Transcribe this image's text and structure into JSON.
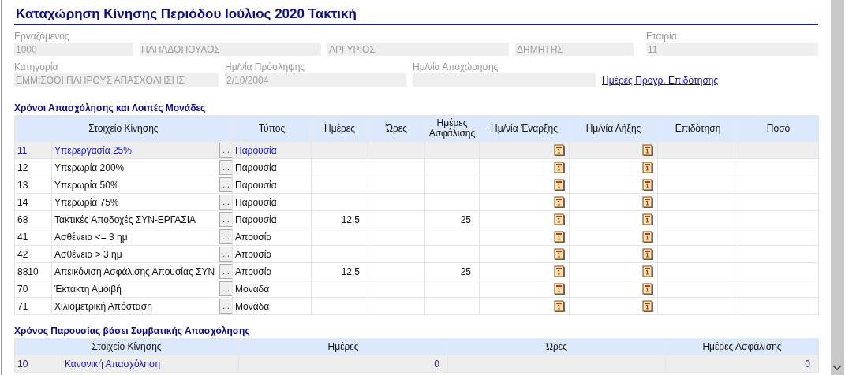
{
  "title": "Καταχώρηση Κίνησης Περιόδου Ιούλιος 2020 Τακτική",
  "employee": {
    "label": "Εργαζόμενος",
    "disabled": true,
    "fields": [
      "1000",
      "ΠΑΠΑΔΟΠΟΥΛΟΣ",
      "ΑΡΓΥΡΙΟΣ",
      "ΔΗΜΗΤΗΣ"
    ]
  },
  "company": {
    "label": "Εταιρία",
    "disabled": true,
    "value": "11"
  },
  "category": {
    "label": "Κατηγορία",
    "disabled": true,
    "value": "ΕΜΜΙΣΘΟΙ ΠΛΗΡΟΥΣ ΑΠΑΣΧΟΛΗΣΗΣ"
  },
  "hire_date": {
    "label": "Ημ/νία Πρόσληψης",
    "disabled": true,
    "value": "2/10/2004"
  },
  "departure_date": {
    "label": "Ημ/νία Αποχώρησης"
  },
  "link": "Ημέρες Προγρ. Επιδότησης",
  "movements": {
    "title": "Χρόνοι Απασχόλησης και Λοιπές Μονάδες",
    "columns": [
      "Στοιχείο Κίνησης",
      "Τύπος",
      "Ημέρες",
      "Ώρες",
      "Ημέρες Ασφάλισης",
      "Ημ/νία Έναρξης",
      "Ημ/νία Λήξης",
      "Επιδότηση",
      "Ποσό"
    ],
    "rows": [
      {
        "code": "11",
        "name": "Υπερεργασία 25%",
        "button": "...",
        "type": "Παρουσία",
        "selected": true
      },
      {
        "code": "12",
        "name": "Υπερωρία 200%",
        "button": "...",
        "type": "Παρουσία",
        "selected": false
      },
      {
        "code": "13",
        "name": "Υπερωρία 50%",
        "button": "...",
        "type": "Παρουσία",
        "selected": false
      },
      {
        "code": "14",
        "name": "Υπερωρία 75%",
        "button": "...",
        "type": "Παρουσία",
        "selected": false
      },
      {
        "code": "68",
        "name": "Τακτικές Αποδοχές ΣΥΝ-ΕΡΓΑΣΙΑ",
        "button": "...",
        "type": "Παρουσία",
        "days": "12,5",
        "insurance_days": "25",
        "selected": false
      },
      {
        "code": "41",
        "name": "Ασθένεια <=  3 ημ",
        "button": "...",
        "type": "Απουσία",
        "selected": false
      },
      {
        "code": "42",
        "name": "Ασθένεια > 3 ημ",
        "button": "...",
        "type": "Απουσία",
        "selected": false
      },
      {
        "code": "8810",
        "name": "Απεικόνιση Ασφάλισης Απουσίας ΣΥΝ",
        "button": "...",
        "type": "Απουσία",
        "days": "12,5",
        "insurance_days": "25",
        "selected": false
      },
      {
        "code": "70",
        "name": "Έκτακτη Αμοιβή",
        "button": "...",
        "type": "Μονάδα",
        "selected": false
      },
      {
        "code": "71",
        "name": "Χιλιομετρική Απόσταση",
        "button": "...",
        "type": "Μονάδα",
        "selected": false
      }
    ]
  },
  "presence": {
    "title": "Χρόνος Παρουσίας βάσει Συμβατικής Απασχόλησης",
    "columns": [
      "Στοιχείο Κίνησης",
      "Ημέρες",
      "Ώρες",
      "Ημέρες Ασφάλισης"
    ],
    "rows": [
      {
        "code": "10",
        "name": "Κανονική Απασχόληση",
        "days": "0",
        "insurance_days": "0",
        "selected": true
      }
    ]
  }
}
